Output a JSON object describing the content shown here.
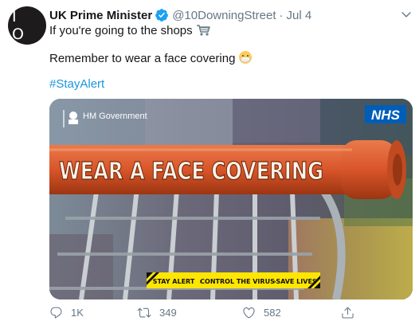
{
  "account": {
    "avatar_text": "I O",
    "name": "UK Prime Minister",
    "handle": "@10DowningStreet",
    "separator": "·",
    "date": "Jul 4"
  },
  "tweet": {
    "line1": "If you're going to the shops",
    "line1_emoji": "shopping-cart-icon",
    "line2": "Remember to wear a face covering",
    "line2_emoji": "face-mask-emoji",
    "hashtag": "#StayAlert"
  },
  "media": {
    "gov_label": "HM Government",
    "nhs_label": "NHS",
    "headline": "WEAR A FACE COVERING",
    "banner": [
      "STAY ALERT",
      "CONTROL THE VIRUS",
      "SAVE LIVES"
    ],
    "colors": {
      "nhs_blue": "#005eb8",
      "banner_yellow": "#ffe600",
      "handle_orange": "#d9552a"
    }
  },
  "actions": {
    "replies": "1K",
    "retweets": "349",
    "likes": "582"
  },
  "colors": {
    "link": "#1b95e0",
    "muted": "#657786",
    "verified": "#1da1f2"
  }
}
